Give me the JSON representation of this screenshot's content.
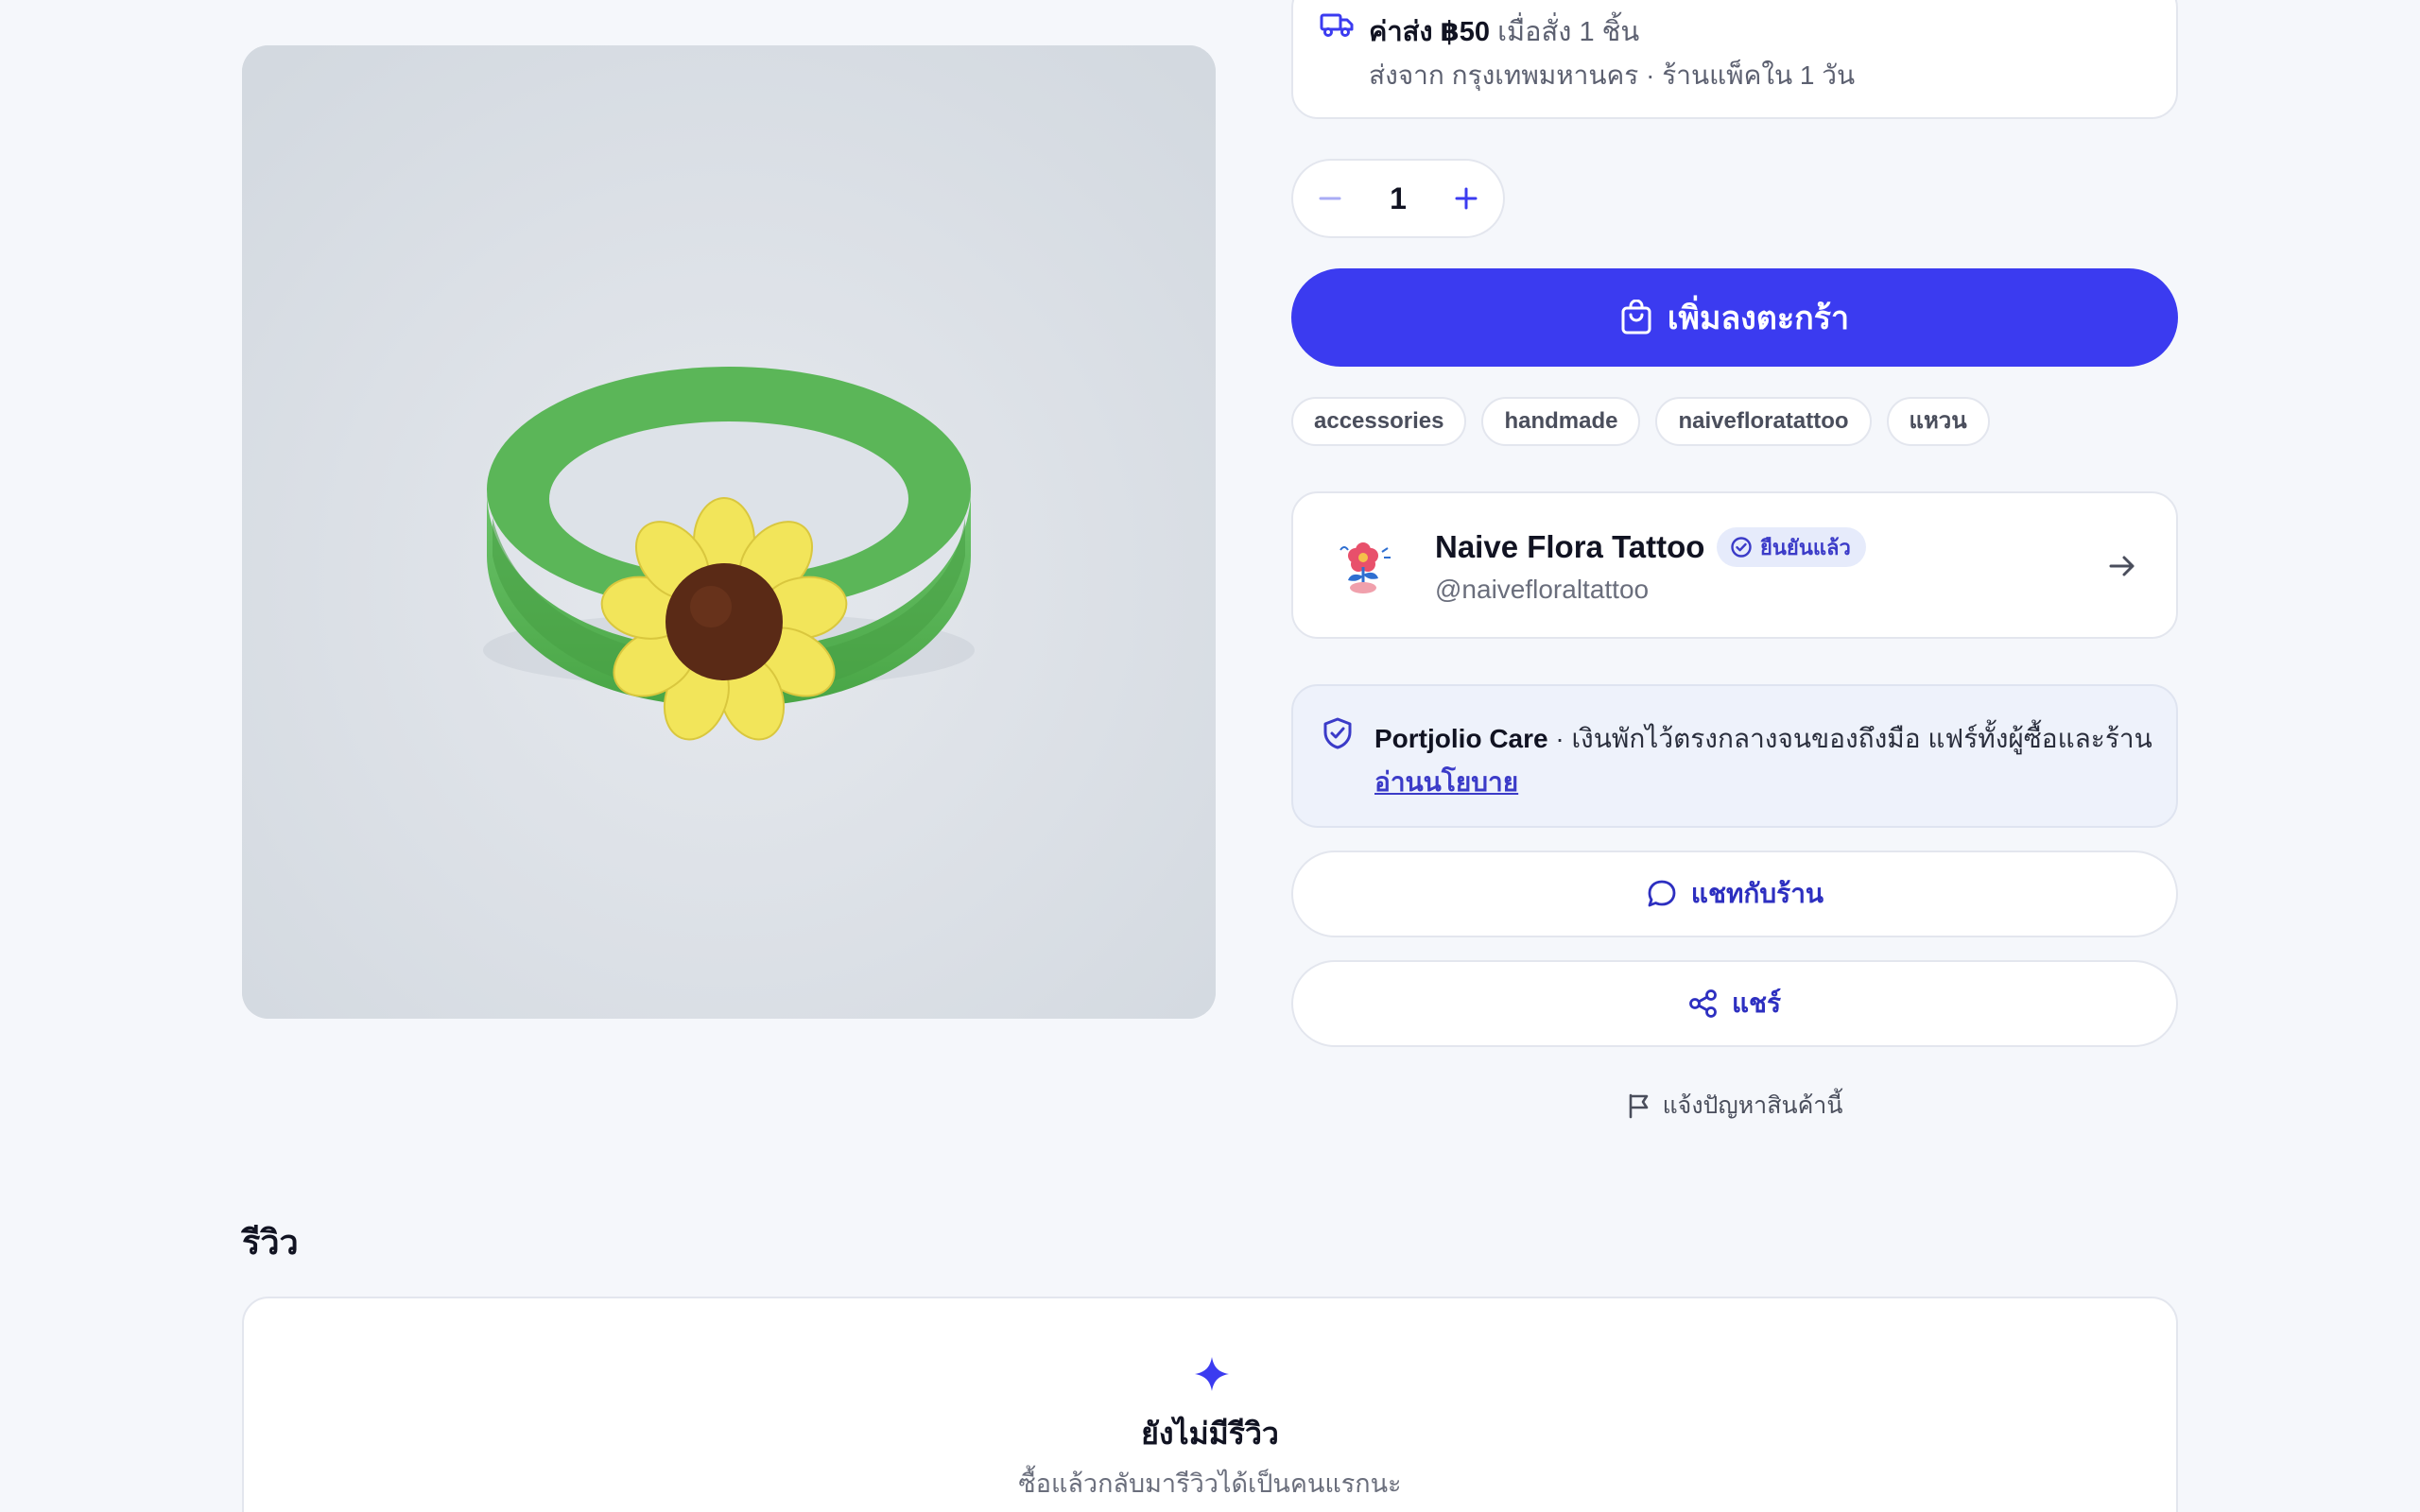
{
  "shipping": {
    "fee_label": "ค่าส่ง ฿50",
    "fee_condition": " เมื่อสั่ง 1 ชิ้น",
    "origin": "ส่งจาก กรุงเทพมหานคร · ร้านแพ็คใน 1 วัน"
  },
  "quantity": {
    "value": "1"
  },
  "cart": {
    "add_label": "เพิ่มลงตะกร้า"
  },
  "tags": [
    "accessories",
    "handmade",
    "naivefloratattoo",
    "แหวน"
  ],
  "shop": {
    "name": "Naive Flora Tattoo",
    "verified_label": "ยืนยันแล้ว",
    "handle": "@naivefloraltattoo"
  },
  "care": {
    "title": "Portjolio Care",
    "description": " · เงินพักไว้ตรงกลางจนของถึงมือ แฟร์ทั้งผู้ซื้อและร้าน",
    "link": "อ่านนโยบาย"
  },
  "actions": {
    "chat_label": "แชทกับร้าน",
    "share_label": "แชร์",
    "report_label": "แจ้งปัญหาสินค้านี้"
  },
  "reviews": {
    "title": "รีวิว",
    "empty_title": "ยังไม่มีรีวิว",
    "empty_subtitle": "ซื้อแล้วกลับมารีวิวได้เป็นคนแรกนะ"
  },
  "colors": {
    "accent": "#3b3bf0",
    "background": "#f5f7fb",
    "verified_bg": "#e6ebfb",
    "care_bg": "#eef2fb"
  },
  "icons": [
    "truck-icon",
    "minus-icon",
    "plus-icon",
    "bag-icon",
    "verified-check-icon",
    "arrow-right-icon",
    "shield-check-icon",
    "chat-bubble-icon",
    "share-icon",
    "flag-icon",
    "sparkle-icon"
  ]
}
